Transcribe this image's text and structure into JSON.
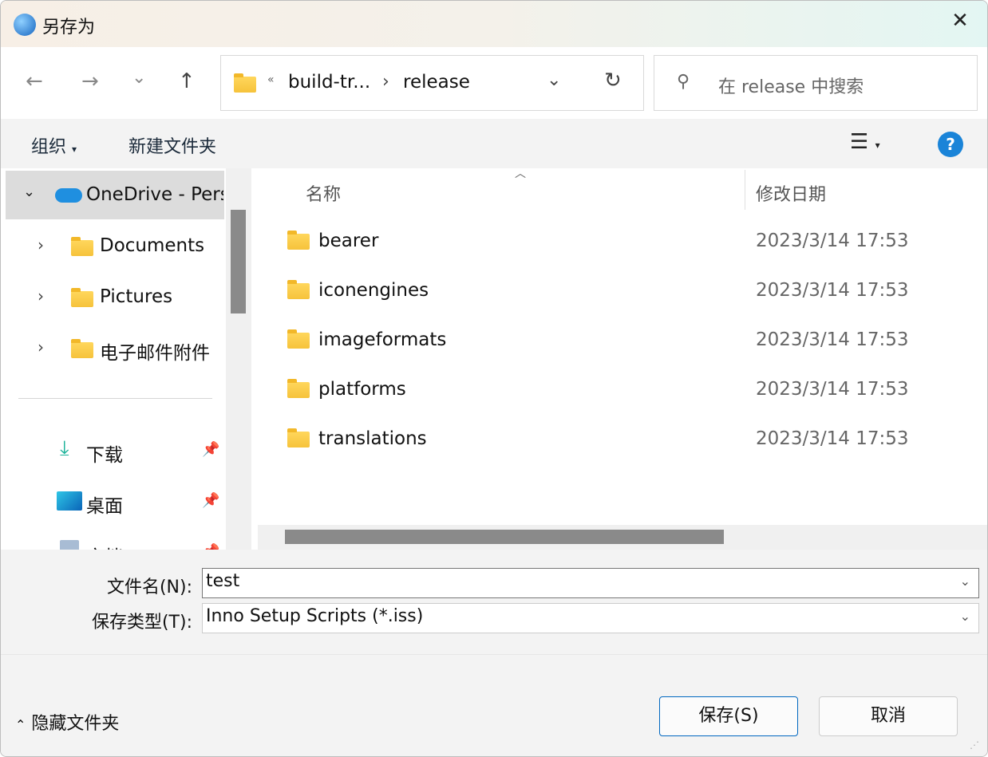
{
  "window": {
    "title": "另存为"
  },
  "nav": {
    "back": "←",
    "forward": "→",
    "recent": "⌄",
    "up": "↑"
  },
  "address": {
    "overflow": "«",
    "crumbs": [
      "build-tr...",
      "release"
    ],
    "separator": "›"
  },
  "search": {
    "placeholder": "在 release 中搜索"
  },
  "toolbar": {
    "organize": "组织",
    "new_folder": "新建文件夹",
    "help": "?"
  },
  "sidebar": {
    "root": {
      "label": "OneDrive - Personal",
      "expanded": true
    },
    "children": [
      {
        "label": "Documents"
      },
      {
        "label": "Pictures"
      },
      {
        "label": "电子邮件附件"
      }
    ],
    "quick": [
      {
        "label": "下载",
        "icon": "download-icon"
      },
      {
        "label": "桌面",
        "icon": "desktop-icon"
      },
      {
        "label": "文档",
        "icon": "documents-icon"
      }
    ]
  },
  "columns": {
    "name": "名称",
    "modified": "修改日期"
  },
  "files": [
    {
      "name": "bearer",
      "date": "2023/3/14 17:53"
    },
    {
      "name": "iconengines",
      "date": "2023/3/14 17:53"
    },
    {
      "name": "imageformats",
      "date": "2023/3/14 17:53"
    },
    {
      "name": "platforms",
      "date": "2023/3/14 17:53"
    },
    {
      "name": "translations",
      "date": "2023/3/14 17:53"
    }
  ],
  "form": {
    "filename_label": "文件名(N):",
    "filename": "test",
    "type_label": "保存类型(T):",
    "type": "Inno Setup Scripts (*.iss)"
  },
  "footer": {
    "hide_folders": "隐藏文件夹",
    "save": "保存(S)",
    "cancel": "取消"
  },
  "colors": {
    "accent": "#0067c0",
    "help": "#1a84d8"
  }
}
